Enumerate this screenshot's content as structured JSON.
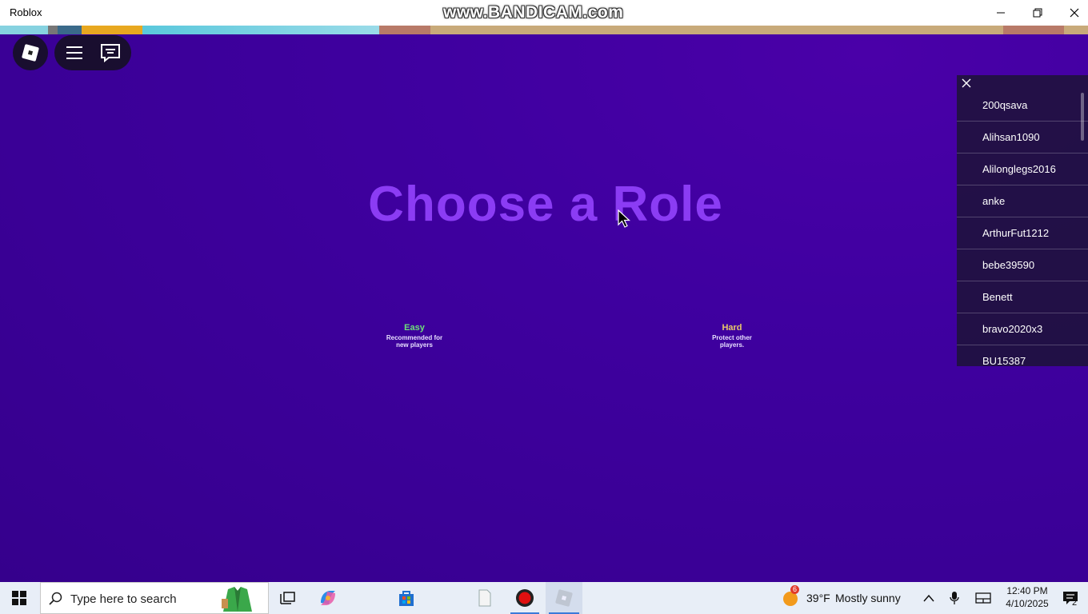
{
  "window": {
    "title": "Roblox",
    "watermark": "www.BANDICAM.com"
  },
  "game": {
    "heading": "Choose a Role",
    "roles": [
      {
        "name": "Easy",
        "description": "Recommended for new players",
        "color": "#6ee07a"
      },
      {
        "name": "Hard",
        "description": "Protect other players.",
        "color": "#e8c86a"
      }
    ]
  },
  "player_list": {
    "players": [
      "200qsava",
      "Alihsan1090",
      "Alilonglegs2016",
      "anke",
      "ArthurFut1212",
      "bebe39590",
      "Benett",
      "bravo2020x3",
      "BU15387"
    ]
  },
  "taskbar": {
    "search_placeholder": "Type here to search",
    "weather": {
      "temp": "39°F",
      "condition": "Mostly sunny",
      "badge": "6"
    },
    "time": "12:40 PM",
    "date": "4/10/2025",
    "notifications": "2"
  },
  "colors": {
    "background": "#3f00a0",
    "heading": "#8b3cf4",
    "accent": "#3b7ad9"
  }
}
